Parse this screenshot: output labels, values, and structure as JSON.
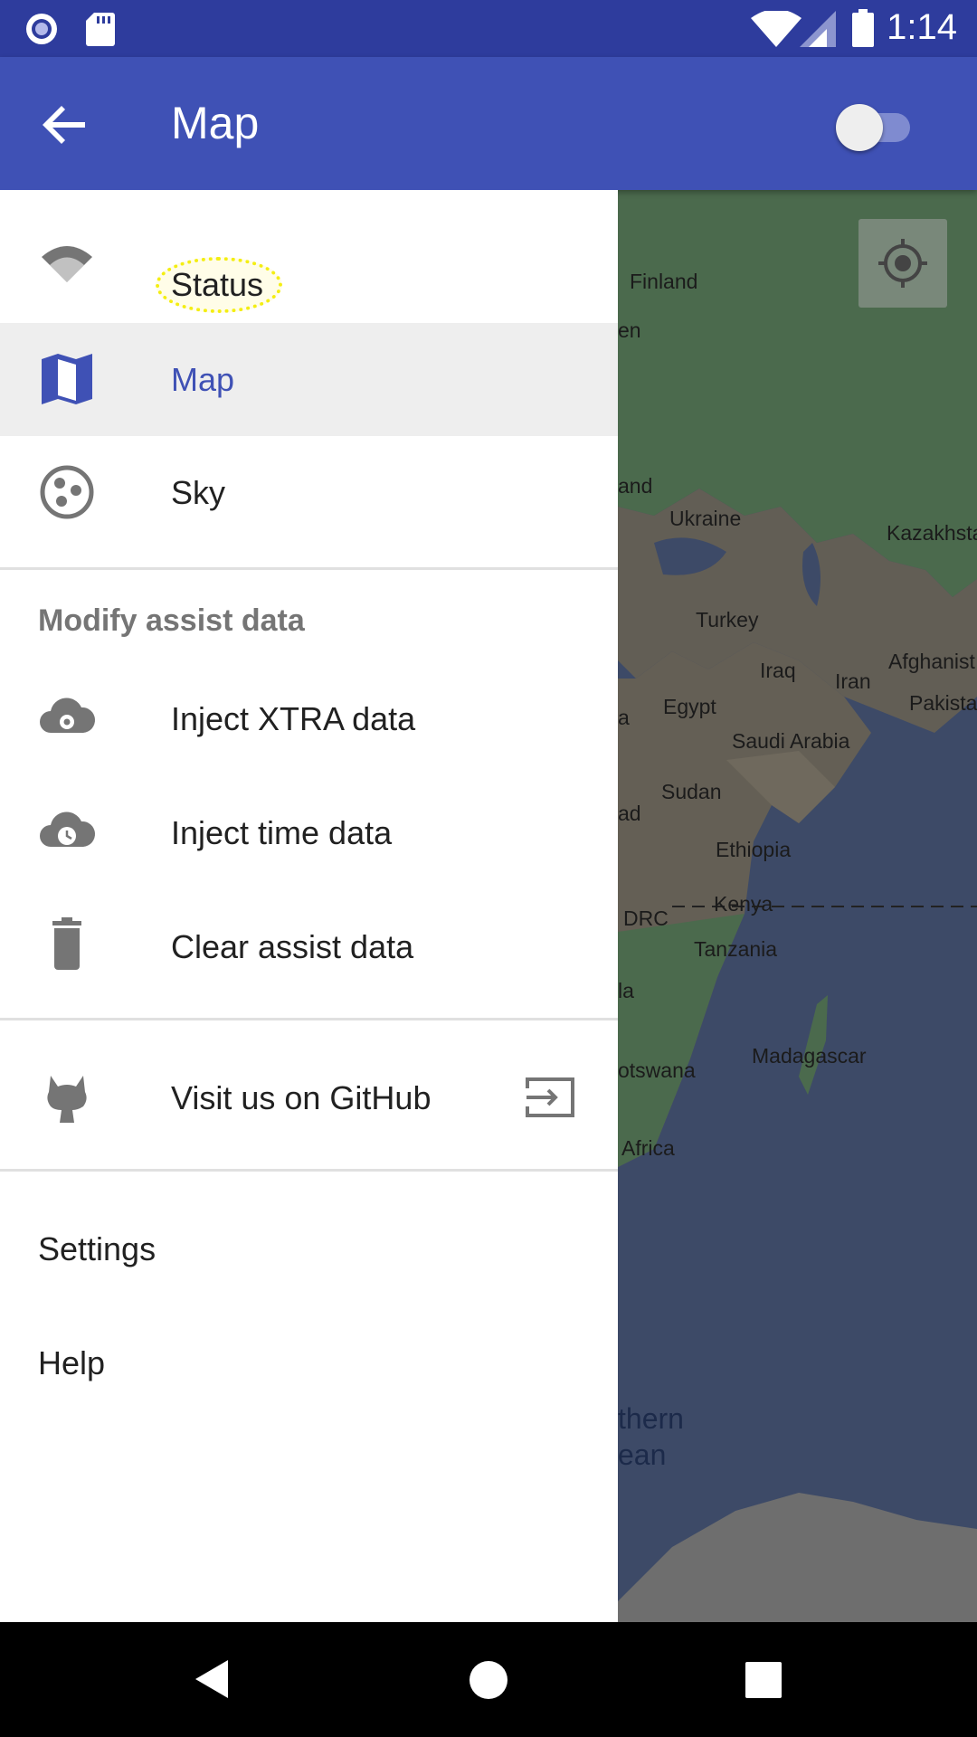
{
  "status_bar": {
    "time": "1:14"
  },
  "app_bar": {
    "title": "Map"
  },
  "drawer": {
    "nav_items": [
      {
        "label": "Status",
        "icon": "wifi-icon"
      },
      {
        "label": "Map",
        "icon": "map-icon"
      },
      {
        "label": "Sky",
        "icon": "sky-icon"
      }
    ],
    "section_header": "Modify assist data",
    "assist_items": [
      {
        "label": "Inject XTRA data",
        "icon": "cloud-gear-icon"
      },
      {
        "label": "Inject time data",
        "icon": "cloud-clock-icon"
      },
      {
        "label": "Clear assist data",
        "icon": "trash-icon"
      }
    ],
    "github_item": {
      "label": "Visit us on GitHub",
      "icon": "github-icon",
      "trailing_icon": "open-external-icon"
    },
    "footer_items": [
      "Settings",
      "Help"
    ]
  },
  "map": {
    "labels": [
      "Finland",
      "en",
      "and",
      "Ukraine",
      "Kazakhsta",
      "Turkey",
      "Afghanist",
      "Iraq",
      "Iran",
      "Pakista",
      "Egypt",
      "a",
      "Saudi Arabia",
      "Sudan",
      "ad",
      "Ethiopia",
      "Kenya",
      "DRC",
      "Tanzania",
      "la",
      "Madagascar",
      "otswana",
      "Africa"
    ],
    "ocean_labels": [
      "thern",
      "ean"
    ]
  },
  "colors": {
    "primary": "#3f51b5",
    "primary_dark": "#2e3c9d",
    "selected_bg": "#eeeeee"
  }
}
